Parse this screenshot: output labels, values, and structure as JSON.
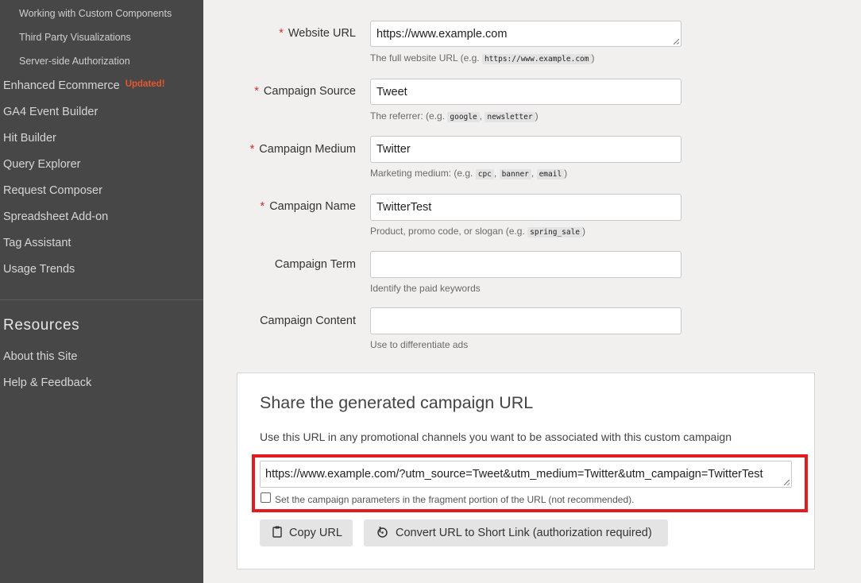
{
  "sidebar": {
    "sub_items": [
      {
        "label": "Working with Custom Components"
      },
      {
        "label": "Third Party Visualizations"
      },
      {
        "label": "Server-side Authorization"
      }
    ],
    "items": [
      {
        "label": "Enhanced Ecommerce",
        "badge": "Updated!"
      },
      {
        "label": "GA4 Event Builder"
      },
      {
        "label": "Hit Builder"
      },
      {
        "label": "Query Explorer"
      },
      {
        "label": "Request Composer"
      },
      {
        "label": "Spreadsheet Add-on"
      },
      {
        "label": "Tag Assistant"
      },
      {
        "label": "Usage Trends"
      }
    ],
    "resources_heading": "Resources",
    "resources": [
      {
        "label": "About this Site"
      },
      {
        "label": "Help & Feedback"
      }
    ]
  },
  "form": {
    "required_marker": "*",
    "website_url": {
      "label": "Website URL",
      "value": "https://www.example.com",
      "hint_prefix": "The full website URL (e.g. ",
      "hint_code": "https://www.example.com",
      "hint_suffix": ")"
    },
    "source": {
      "label": "Campaign Source",
      "value": "Tweet",
      "hint_prefix": "The referrer: (e.g. ",
      "hint_code_1": "google",
      "hint_sep": ", ",
      "hint_code_2": "newsletter",
      "hint_suffix": ")"
    },
    "medium": {
      "label": "Campaign Medium",
      "value": "Twitter",
      "hint_prefix": "Marketing medium: (e.g. ",
      "hint_code_1": "cpc",
      "hint_sep": ", ",
      "hint_code_2": "banner",
      "hint_code_3": "email",
      "hint_suffix": ")"
    },
    "name": {
      "label": "Campaign Name",
      "value": "TwitterTest",
      "hint_prefix": "Product, promo code, or slogan (e.g. ",
      "hint_code": "spring_sale",
      "hint_suffix": ")"
    },
    "term": {
      "label": "Campaign Term",
      "value": "",
      "hint": "Identify the paid keywords"
    },
    "content": {
      "label": "Campaign Content",
      "value": "",
      "hint": "Use to differentiate ads"
    }
  },
  "share": {
    "title": "Share the generated campaign URL",
    "description": "Use this URL in any promotional channels you want to be associated with this custom campaign",
    "generated_url": "https://www.example.com/?utm_source=Tweet&utm_medium=Twitter&utm_campaign=TwitterTest",
    "fragment_checkbox_label": "Set the campaign parameters in the fragment portion of the URL (not recommended).",
    "fragment_checked": false,
    "copy_button": "Copy URL",
    "convert_button": "Convert URL to Short Link (authorization required)",
    "highlight_color": "#e21b23"
  },
  "icons": {
    "copy": "clipboard-icon",
    "convert": "bitly-icon"
  }
}
